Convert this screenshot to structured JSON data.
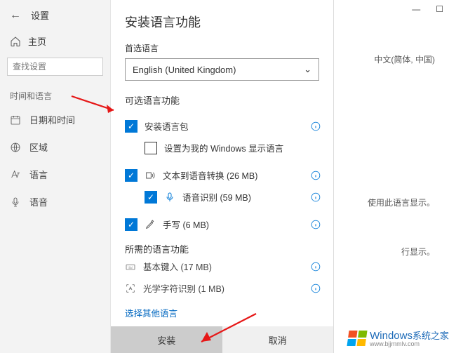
{
  "sidebar": {
    "settings_label": "设置",
    "home_label": "主页",
    "search_placeholder": "查找设置",
    "section_label": "时间和语言",
    "items": [
      {
        "label": "日期和时间"
      },
      {
        "label": "区域"
      },
      {
        "label": "语言"
      },
      {
        "label": "语音"
      }
    ]
  },
  "dialog": {
    "title": "安装语言功能",
    "preferred_label": "首选语言",
    "selected_language": "English (United Kingdom)",
    "optional_label": "可选语言功能",
    "rows": {
      "install_pack": "安装语言包",
      "set_display": "设置为我的 Windows 显示语言",
      "tts": "文本到语音转换 (26 MB)",
      "speech": "语音识别 (59 MB)",
      "handwriting": "手写 (6 MB)"
    },
    "required_label": "所需的语言功能",
    "required_rows": {
      "typing": "基本键入 (17 MB)",
      "ocr": "光学字符识别 (1 MB)"
    },
    "other_link": "选择其他语言",
    "install_btn": "安装",
    "cancel_btn": "取消"
  },
  "main_fragments": {
    "f1": "中文(简体, 中国)",
    "f2": "使用此语言显示。",
    "f3": "行显示。"
  },
  "watermark": {
    "brand": "Windows",
    "tagline": "系统之家",
    "url": "www.bjjmmlv.com"
  }
}
